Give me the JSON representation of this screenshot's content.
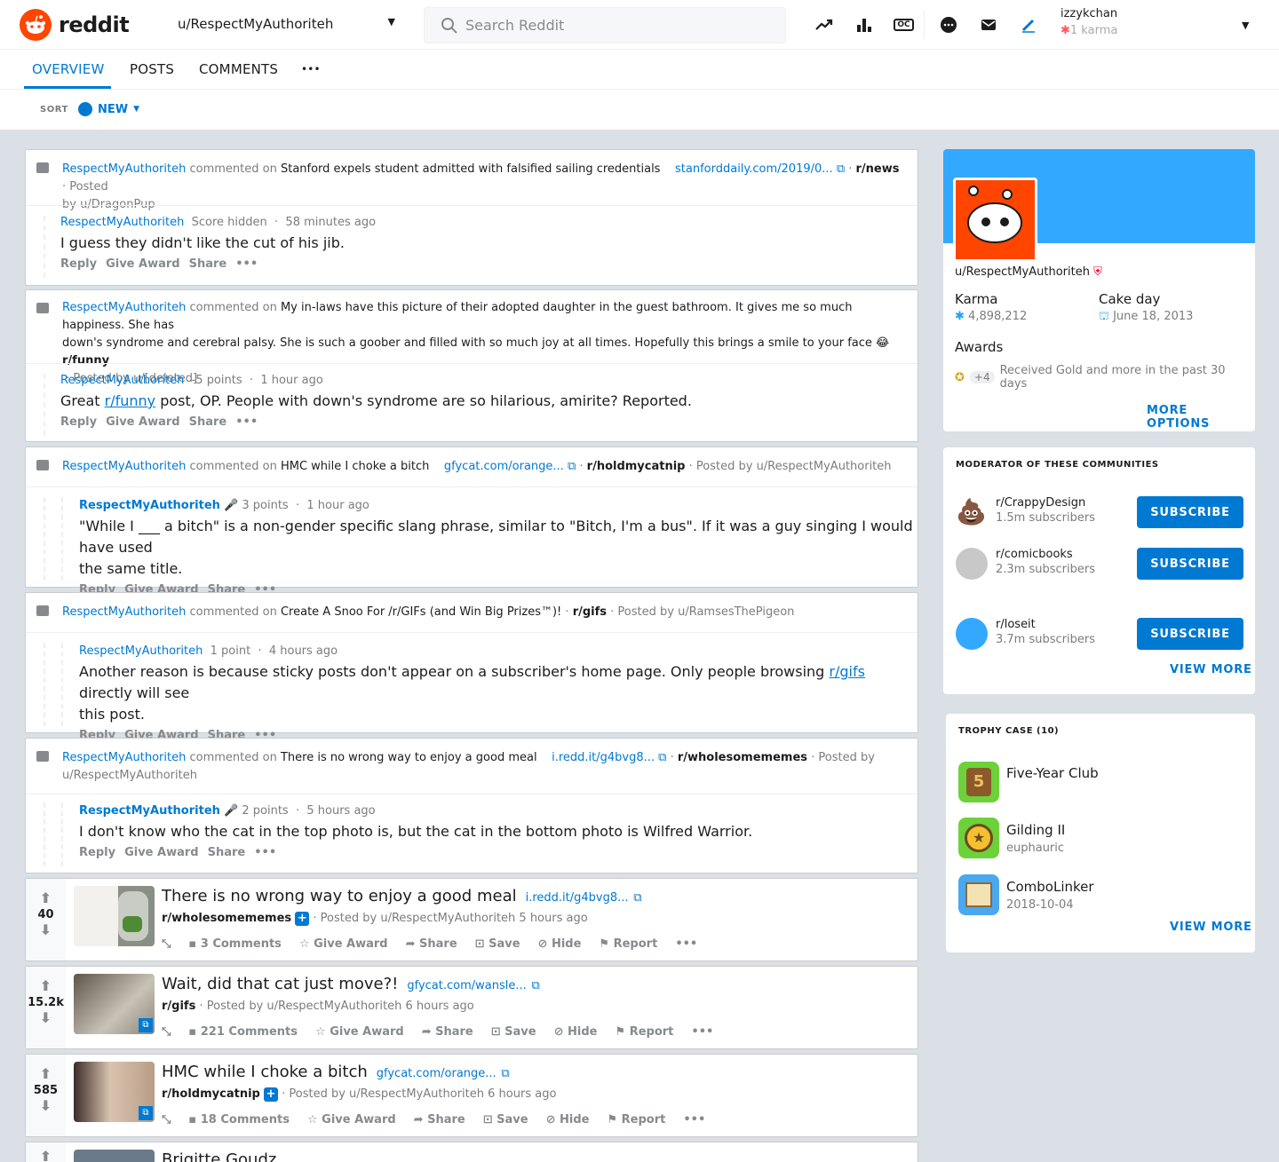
{
  "header": {
    "logo_text": "reddit",
    "profile_dropdown": "u/RespectMyAuthoriteh",
    "search_placeholder": "Search Reddit",
    "account_name": "izzykchan",
    "account_karma": "1 karma",
    "icons": [
      "trending-icon",
      "leaderboard-icon",
      "oc-icon",
      "chat-icon",
      "mail-icon",
      "pencil-icon"
    ],
    "oc_label": "OC"
  },
  "tabs": {
    "overview": "OVERVIEW",
    "posts": "POSTS",
    "comments": "COMMENTS",
    "more": "•••"
  },
  "sort": {
    "label": "SORT",
    "value": "NEW"
  },
  "comments": [
    {
      "author": "RespectMyAuthoriteh",
      "verb": "commented on",
      "title": "Stanford expels student admitted with falsified sailing credentials",
      "domain": "stanforddaily.com/2019/0...",
      "subreddit": "r/news",
      "posted_prefix": "· Posted",
      "posted_by": "by u/DragonPup",
      "c_author": "RespectMyAuthoriteh",
      "c_score": "Score hidden",
      "c_time": "58 minutes ago",
      "c_text": "I guess they didn't like the cut of his jib."
    },
    {
      "author": "RespectMyAuthoriteh",
      "verb": "commented on",
      "title_line1": "My in-laws have this picture of their adopted daughter in the guest bathroom. It gives me so much happiness. She has",
      "title_line2": "down's syndrome and cerebral palsy. She is such a goober and filled with so much joy at all times. Hopefully this brings a smile to your face 😂",
      "subreddit": "r/funny",
      "posted_by": "· Posted by u/[deleted]",
      "c_author": "RespectMyAuthoriteh",
      "c_score": "-5 points",
      "c_time": "1 hour ago",
      "c_text_pre": "Great ",
      "c_link": "r/funny",
      "c_text_post": " post, OP. People with down's syndrome are so hilarious, amirite? Reported."
    },
    {
      "author": "RespectMyAuthoriteh",
      "verb": "commented on",
      "title": "HMC while I choke a bitch",
      "domain": "gfycat.com/orange...",
      "subreddit": "r/holdmycatnip",
      "posted_by": "· Posted by u/RespectMyAuthoriteh",
      "c_author": "RespectMyAuthoriteh",
      "c_score": "3 points",
      "c_time": "1 hour ago",
      "c_text_l1": "\"While I ___ a bitch\" is a non-gender specific slang phrase, similar to \"Bitch, I'm a bus\". If it was a guy singing I would have used",
      "c_text_l2": "the same title."
    },
    {
      "author": "RespectMyAuthoriteh",
      "verb": "commented on",
      "title": "Create A Snoo For /r/GIFs (and Win Big Prizes™)!",
      "subreddit": "r/gifs",
      "posted_by": "· Posted by u/RamsesThePigeon",
      "c_author": "RespectMyAuthoriteh",
      "c_score": "1 point",
      "c_time": "4 hours ago",
      "c_text_pre": "Another reason is because sticky posts don't appear on a subscriber's home page. Only people browsing ",
      "c_link": "r/gifs",
      "c_text_post": " directly will see",
      "c_text_l2": "this post."
    },
    {
      "author": "RespectMyAuthoriteh",
      "verb": "commented on",
      "title": "There is no wrong way to enjoy a good meal",
      "domain": "i.redd.it/g4bvg8...",
      "subreddit": "r/wholesomememes",
      "posted_prefix": "· Posted by",
      "posted_by": "u/RespectMyAuthoriteh",
      "c_author": "RespectMyAuthoriteh",
      "c_score": "2 points",
      "c_time": "5 hours ago",
      "c_text": "I don't know who the cat in the top photo is, but the cat in the bottom photo is Wilfred Warrior."
    }
  ],
  "comment_actions": {
    "reply": "Reply",
    "award": "Give Award",
    "share": "Share",
    "more": "•••"
  },
  "posts": [
    {
      "score": "40",
      "title": "There is no wrong way to enjoy a good meal",
      "domain": "i.redd.it/g4bvg8...",
      "subreddit": "r/wholesomememes",
      "posted": "· Posted by u/RespectMyAuthoriteh 5 hours ago",
      "comments": "3 Comments"
    },
    {
      "score": "15.2k",
      "title": "Wait, did that cat just move?!",
      "domain": "gfycat.com/wansle...",
      "subreddit": "r/gifs",
      "posted": "· Posted by u/RespectMyAuthoriteh 6 hours ago",
      "comments": "221 Comments"
    },
    {
      "score": "585",
      "title": "HMC while I choke a bitch",
      "domain": "gfycat.com/orange...",
      "subreddit": "r/holdmycatnip",
      "posted": "· Posted by u/RespectMyAuthoriteh 6 hours ago",
      "comments": "18 Comments"
    },
    {
      "title": "Brigitte Goudz"
    }
  ],
  "post_actions": {
    "award": "Give Award",
    "share": "Share",
    "save": "Save",
    "hide": "Hide",
    "report": "Report",
    "more": "•••"
  },
  "profile": {
    "username": "u/RespectMyAuthoriteh",
    "karma_label": "Karma",
    "karma_value": "4,898,212",
    "cakeday_label": "Cake day",
    "cakeday_value": "June 18, 2013",
    "awards_label": "Awards",
    "awards_count": "+4",
    "awards_text": "Received Gold and more in the past 30 days",
    "more_options": "MORE OPTIONS",
    "banner_color": "#33a8ff"
  },
  "moderator": {
    "title": "MODERATOR OF THESE COMMUNITIES",
    "communities": [
      {
        "name": "r/CrappyDesign",
        "subs": "1.5m subscribers",
        "btn": "SUBSCRIBE",
        "icon": "💩"
      },
      {
        "name": "r/comicbooks",
        "subs": "2.3m subscribers",
        "btn": "SUBSCRIBE"
      },
      {
        "name": "r/loseit",
        "subs": "3.7m subscribers",
        "btn": "SUBSCRIBE"
      }
    ],
    "view_more": "VIEW MORE"
  },
  "trophies": {
    "title": "TROPHY CASE (10)",
    "items": [
      {
        "name": "Five-Year Club",
        "sub": ""
      },
      {
        "name": "Gilding II",
        "sub": "euphauric"
      },
      {
        "name": "ComboLinker",
        "sub": "2018-10-04"
      }
    ],
    "view_more": "VIEW MORE"
  },
  "colors": {
    "accent": "#0079d3",
    "brand": "#ff4500",
    "bg": "#dae0e6"
  }
}
